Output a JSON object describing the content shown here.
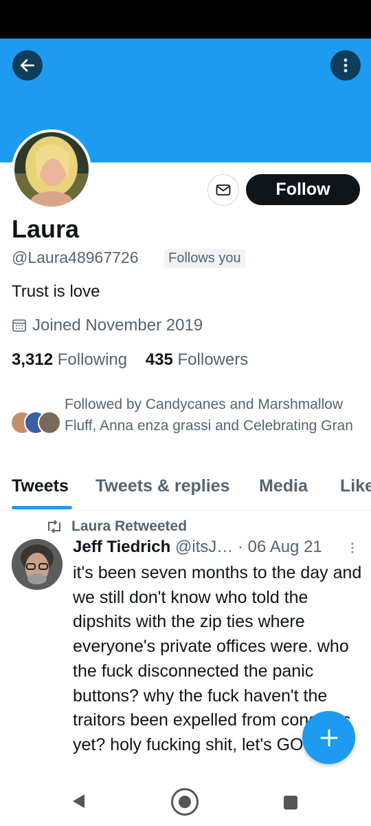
{
  "header": {
    "back_icon": "arrow-left-icon",
    "more_icon": "vertical-dots-icon",
    "banner_color": "#1d9bf0"
  },
  "profile": {
    "name": "Laura",
    "handle": "@Laura48967726",
    "follows_you": "Follows you",
    "bio": "Trust is love",
    "joined": "Joined November 2019",
    "following_count": "3,312",
    "following_label": "Following",
    "followers_count": "435",
    "followers_label": "Followers",
    "followed_by": "Followed by Candycanes and Marshmallow Fluff, Anna enza  grassi and Celebrating Gran",
    "follow_label": "Follow",
    "message_icon": "envelope-icon"
  },
  "tabs": [
    {
      "label": "Tweets",
      "active": true
    },
    {
      "label": "Tweets & replies",
      "active": false
    },
    {
      "label": "Media",
      "active": false
    },
    {
      "label": "Likes",
      "active": false
    }
  ],
  "tweet": {
    "retweet_label": "Laura Retweeted",
    "author": "Jeff Tiedrich",
    "handle": "@itsJ…",
    "separator": "·",
    "date": "06 Aug 21",
    "text": "it's been seven months to the day and we still don't know who told the dipshits with the zip ties where everyone's private offices were. who the fuck disconnected the panic buttons? why the fuck haven't the traitors been expelled from congress yet? holy fucking shit, let's GO"
  },
  "fab": {
    "icon": "plus-icon"
  },
  "colors": {
    "accent": "#1d9bf0",
    "text": "#0f1419",
    "secondary": "#536471"
  }
}
